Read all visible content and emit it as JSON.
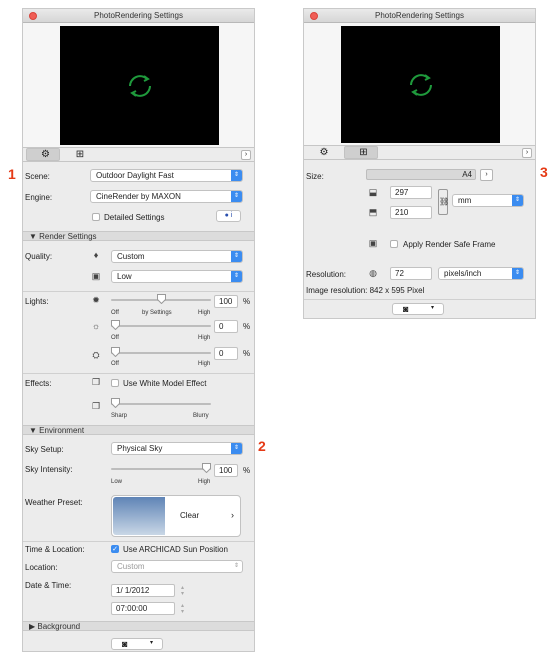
{
  "left": {
    "title": "PhotoRendering Settings",
    "scene_label": "Scene:",
    "scene_value": "Outdoor Daylight Fast",
    "engine_label": "Engine:",
    "engine_value": "CineRender by MAXON",
    "detailed_settings": "Detailed Settings",
    "render_settings_header": "Render Settings",
    "quality_label": "Quality:",
    "quality_value": "Custom",
    "quality2_value": "Low",
    "lights_label": "Lights:",
    "light1_value": "100",
    "light2_value": "0",
    "light3_value": "0",
    "pct": "%",
    "off": "Off",
    "by_settings": "by Settings",
    "high": "High",
    "effects_label": "Effects:",
    "white_model": "Use White Model Effect",
    "sharp": "Sharp",
    "blurry": "Blurry",
    "environment_header": "Environment",
    "sky_setup_label": "Sky Setup:",
    "sky_setup_value": "Physical Sky",
    "sky_intensity_label": "Sky Intensity:",
    "sky_intensity_value": "100",
    "low": "Low",
    "weather_label": "Weather Preset:",
    "weather_value": "Clear",
    "time_location_label": "Time & Location:",
    "use_sun": "Use ARCHICAD Sun Position",
    "location_label": "Location:",
    "location_value": "Custom",
    "date_time_label": "Date & Time:",
    "date_value": "1/  1/2012",
    "time_value": "07:00:00",
    "background_header": "Background"
  },
  "right": {
    "title": "PhotoRendering Settings",
    "size_label": "Size:",
    "size_value": "A4",
    "width_value": "297",
    "height_value": "210",
    "unit_value": "mm",
    "safe_frame": "Apply Render Safe Frame",
    "resolution_label": "Resolution:",
    "resolution_value": "72",
    "resolution_unit": "pixels/inch",
    "image_resolution": "Image resolution: 842 x 595 Pixel"
  },
  "markers": {
    "m1": "1",
    "m2": "2",
    "m3": "3"
  },
  "colors": {
    "accent": "#3b8cf0",
    "marker": "#e53a16",
    "refresh": "#1f9a3c"
  }
}
